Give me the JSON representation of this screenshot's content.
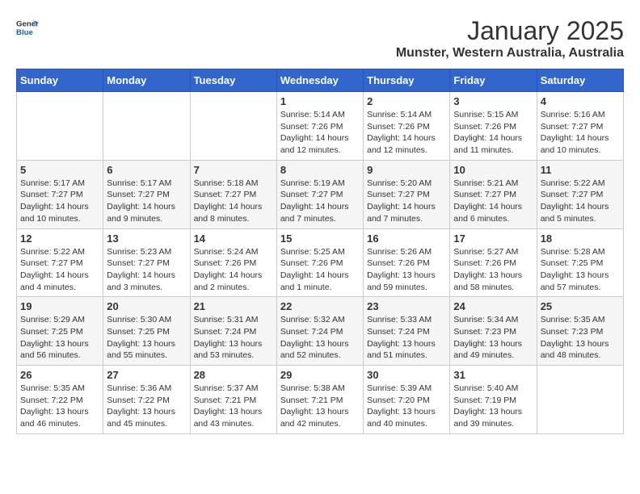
{
  "header": {
    "logo_text_general": "General",
    "logo_text_blue": "Blue",
    "title": "January 2025",
    "subtitle": "Munster, Western Australia, Australia"
  },
  "calendar": {
    "days_of_week": [
      "Sunday",
      "Monday",
      "Tuesday",
      "Wednesday",
      "Thursday",
      "Friday",
      "Saturday"
    ],
    "weeks": [
      [
        {
          "day": "",
          "info": ""
        },
        {
          "day": "",
          "info": ""
        },
        {
          "day": "",
          "info": ""
        },
        {
          "day": "1",
          "info": "Sunrise: 5:14 AM\nSunset: 7:26 PM\nDaylight: 14 hours\nand 12 minutes."
        },
        {
          "day": "2",
          "info": "Sunrise: 5:14 AM\nSunset: 7:26 PM\nDaylight: 14 hours\nand 12 minutes."
        },
        {
          "day": "3",
          "info": "Sunrise: 5:15 AM\nSunset: 7:26 PM\nDaylight: 14 hours\nand 11 minutes."
        },
        {
          "day": "4",
          "info": "Sunrise: 5:16 AM\nSunset: 7:27 PM\nDaylight: 14 hours\nand 10 minutes."
        }
      ],
      [
        {
          "day": "5",
          "info": "Sunrise: 5:17 AM\nSunset: 7:27 PM\nDaylight: 14 hours\nand 10 minutes."
        },
        {
          "day": "6",
          "info": "Sunrise: 5:17 AM\nSunset: 7:27 PM\nDaylight: 14 hours\nand 9 minutes."
        },
        {
          "day": "7",
          "info": "Sunrise: 5:18 AM\nSunset: 7:27 PM\nDaylight: 14 hours\nand 8 minutes."
        },
        {
          "day": "8",
          "info": "Sunrise: 5:19 AM\nSunset: 7:27 PM\nDaylight: 14 hours\nand 7 minutes."
        },
        {
          "day": "9",
          "info": "Sunrise: 5:20 AM\nSunset: 7:27 PM\nDaylight: 14 hours\nand 7 minutes."
        },
        {
          "day": "10",
          "info": "Sunrise: 5:21 AM\nSunset: 7:27 PM\nDaylight: 14 hours\nand 6 minutes."
        },
        {
          "day": "11",
          "info": "Sunrise: 5:22 AM\nSunset: 7:27 PM\nDaylight: 14 hours\nand 5 minutes."
        }
      ],
      [
        {
          "day": "12",
          "info": "Sunrise: 5:22 AM\nSunset: 7:27 PM\nDaylight: 14 hours\nand 4 minutes."
        },
        {
          "day": "13",
          "info": "Sunrise: 5:23 AM\nSunset: 7:27 PM\nDaylight: 14 hours\nand 3 minutes."
        },
        {
          "day": "14",
          "info": "Sunrise: 5:24 AM\nSunset: 7:26 PM\nDaylight: 14 hours\nand 2 minutes."
        },
        {
          "day": "15",
          "info": "Sunrise: 5:25 AM\nSunset: 7:26 PM\nDaylight: 14 hours\nand 1 minute."
        },
        {
          "day": "16",
          "info": "Sunrise: 5:26 AM\nSunset: 7:26 PM\nDaylight: 13 hours\nand 59 minutes."
        },
        {
          "day": "17",
          "info": "Sunrise: 5:27 AM\nSunset: 7:26 PM\nDaylight: 13 hours\nand 58 minutes."
        },
        {
          "day": "18",
          "info": "Sunrise: 5:28 AM\nSunset: 7:25 PM\nDaylight: 13 hours\nand 57 minutes."
        }
      ],
      [
        {
          "day": "19",
          "info": "Sunrise: 5:29 AM\nSunset: 7:25 PM\nDaylight: 13 hours\nand 56 minutes."
        },
        {
          "day": "20",
          "info": "Sunrise: 5:30 AM\nSunset: 7:25 PM\nDaylight: 13 hours\nand 55 minutes."
        },
        {
          "day": "21",
          "info": "Sunrise: 5:31 AM\nSunset: 7:24 PM\nDaylight: 13 hours\nand 53 minutes."
        },
        {
          "day": "22",
          "info": "Sunrise: 5:32 AM\nSunset: 7:24 PM\nDaylight: 13 hours\nand 52 minutes."
        },
        {
          "day": "23",
          "info": "Sunrise: 5:33 AM\nSunset: 7:24 PM\nDaylight: 13 hours\nand 51 minutes."
        },
        {
          "day": "24",
          "info": "Sunrise: 5:34 AM\nSunset: 7:23 PM\nDaylight: 13 hours\nand 49 minutes."
        },
        {
          "day": "25",
          "info": "Sunrise: 5:35 AM\nSunset: 7:23 PM\nDaylight: 13 hours\nand 48 minutes."
        }
      ],
      [
        {
          "day": "26",
          "info": "Sunrise: 5:35 AM\nSunset: 7:22 PM\nDaylight: 13 hours\nand 46 minutes."
        },
        {
          "day": "27",
          "info": "Sunrise: 5:36 AM\nSunset: 7:22 PM\nDaylight: 13 hours\nand 45 minutes."
        },
        {
          "day": "28",
          "info": "Sunrise: 5:37 AM\nSunset: 7:21 PM\nDaylight: 13 hours\nand 43 minutes."
        },
        {
          "day": "29",
          "info": "Sunrise: 5:38 AM\nSunset: 7:21 PM\nDaylight: 13 hours\nand 42 minutes."
        },
        {
          "day": "30",
          "info": "Sunrise: 5:39 AM\nSunset: 7:20 PM\nDaylight: 13 hours\nand 40 minutes."
        },
        {
          "day": "31",
          "info": "Sunrise: 5:40 AM\nSunset: 7:19 PM\nDaylight: 13 hours\nand 39 minutes."
        },
        {
          "day": "",
          "info": ""
        }
      ]
    ]
  }
}
